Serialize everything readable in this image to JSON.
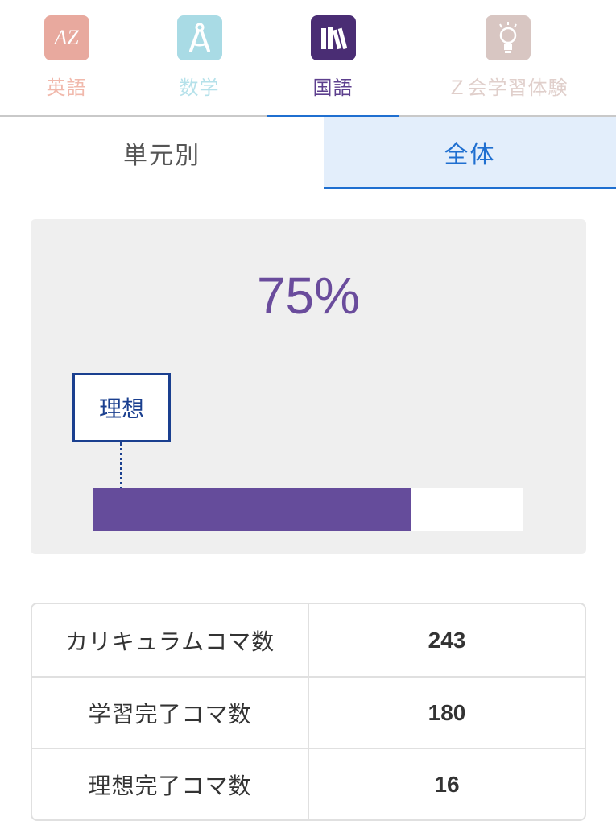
{
  "subjects": [
    {
      "label": "英語",
      "icon": "az-icon",
      "icon_text": "AZ",
      "color": "#e8a99e",
      "text_color": "#f1b9ac",
      "active": false
    },
    {
      "label": "数学",
      "icon": "compass-icon",
      "color": "#a9dbe5",
      "text_color": "#b5e1ea",
      "active": false
    },
    {
      "label": "国語",
      "icon": "books-icon",
      "color": "#4a2d74",
      "text_color": "#5d3f8e",
      "active": true
    },
    {
      "label": "Ｚ会学習体験",
      "icon": "lightbulb-icon",
      "color": "#d8c6c2",
      "text_color": "#e0cfcb",
      "active": false
    }
  ],
  "active_underline_color": "#1f6fd0",
  "view_tabs": {
    "by_unit": "単元別",
    "overall": "全体"
  },
  "progress": {
    "percent_text": "75%",
    "completion_fraction": 0.74,
    "ideal_label": "理想",
    "ideal_fraction": 0.065,
    "bar_color": "#654c9b",
    "ideal_color": "#1a3f8f"
  },
  "stats": [
    {
      "label": "カリキュラムコマ数",
      "value": "243"
    },
    {
      "label": "学習完了コマ数",
      "value": "180"
    },
    {
      "label": "理想完了コマ数",
      "value": "16"
    }
  ]
}
